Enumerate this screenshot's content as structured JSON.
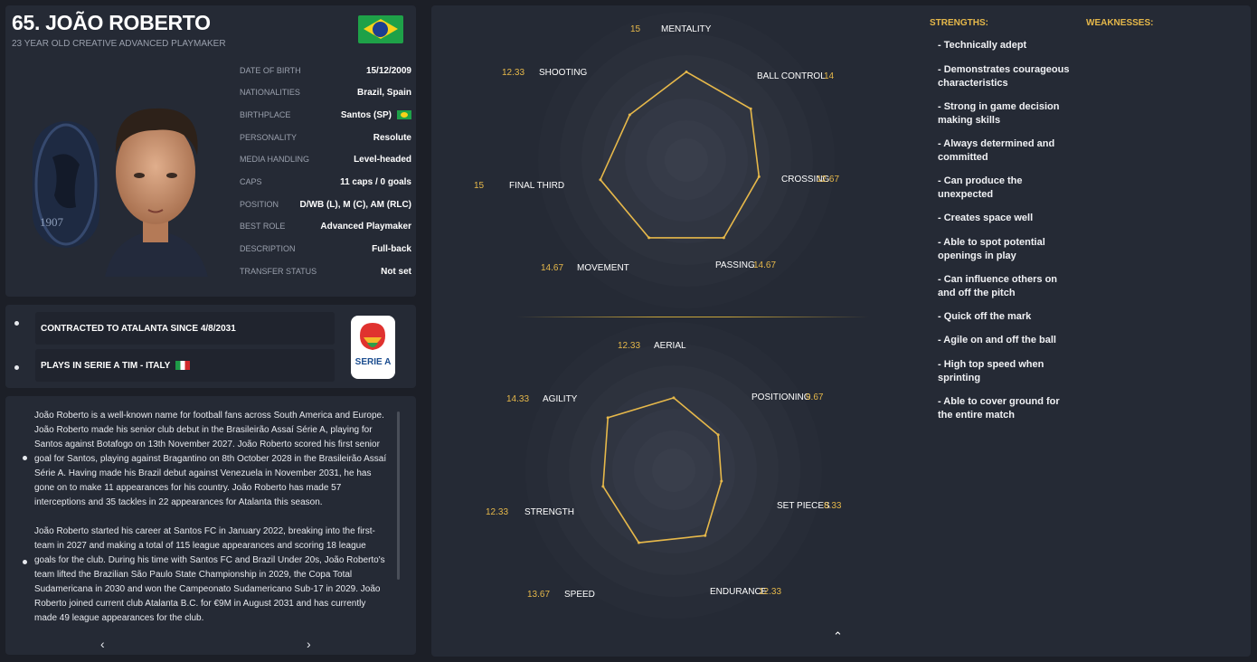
{
  "player": {
    "name": "65. JOÃO ROBERTO",
    "subtitle": "23 YEAR OLD CREATIVE ADVANCED PLAYMAKER",
    "club_crest_text": "1907"
  },
  "info": [
    {
      "label": "DATE OF BIRTH",
      "value": "15/12/2009"
    },
    {
      "label": "NATIONALITIES",
      "value": "Brazil, Spain"
    },
    {
      "label": "BIRTHPLACE",
      "value": "Santos (SP)"
    },
    {
      "label": "PERSONALITY",
      "value": "Resolute"
    },
    {
      "label": "MEDIA HANDLING",
      "value": "Level-headed"
    },
    {
      "label": "CAPS",
      "value": "11 caps / 0 goals"
    },
    {
      "label": "POSITION",
      "value": "D/WB (L), M (C), AM (RLC)"
    },
    {
      "label": "BEST ROLE",
      "value": "Advanced Playmaker"
    },
    {
      "label": "DESCRIPTION",
      "value": "Full-back"
    },
    {
      "label": "TRANSFER STATUS",
      "value": "Not set"
    }
  ],
  "contract": {
    "line1": "CONTRACTED TO ATALANTA SINCE 4/8/2031",
    "line2": "PLAYS IN SERIE A TIM - ITALY",
    "league_name": "SERIE A"
  },
  "bio": {
    "para1": "João Roberto is a well-known name for football fans across South America and Europe. João Roberto made his senior club debut in the Brasileirão Assaí Série A, playing for Santos against Botafogo on 13th November 2027. João Roberto scored his first senior goal for Santos, playing against Bragantino on 8th October 2028 in the Brasileirão Assaí Série A. Having made his Brazil debut against Venezuela in November 2031, he has gone on to make 11 appearances for his country. João Roberto has made 57 interceptions and 35 tackles in 22 appearances for Atalanta this season.",
    "para2": "João Roberto started his career at Santos FC in January 2022, breaking into the first-team in 2027 and making a total of 115 league appearances and scoring 18 league goals for the club. During his time with Santos FC and Brazil Under 20s, João Roberto's team lifted the Brazilian São Paulo State Championship in 2029, the Copa Total Sudamericana in 2030 and won the Campeonato Sudamericano Sub-17 in 2029. João Roberto joined current club Atalanta B.C. for €9M in August 2031 and has currently made 49 league appearances for the club.",
    "prev": "‹",
    "next": "›"
  },
  "radar_top": [
    {
      "label": "MENTALITY",
      "value": "15",
      "v": 15
    },
    {
      "label": "BALL CONTROL",
      "value": "14",
      "v": 14
    },
    {
      "label": "CROSSING",
      "value": "12.67",
      "v": 12.67
    },
    {
      "label": "PASSING",
      "value": "14.67",
      "v": 14.67
    },
    {
      "label": "MOVEMENT",
      "value": "14.67",
      "v": 14.67
    },
    {
      "label": "FINAL THIRD",
      "value": "15",
      "v": 15
    },
    {
      "label": "SHOOTING",
      "value": "12.33",
      "v": 12.33
    }
  ],
  "radar_bottom": [
    {
      "label": "AERIAL",
      "value": "12.33",
      "v": 12.33
    },
    {
      "label": "POSITIONING",
      "value": "9.67",
      "v": 9.67
    },
    {
      "label": "SET PIECES",
      "value": "8.33",
      "v": 8.33
    },
    {
      "label": "ENDURANCE",
      "value": "12.33",
      "v": 12.33
    },
    {
      "label": "SPEED",
      "value": "13.67",
      "v": 13.67
    },
    {
      "label": "STRENGTH",
      "value": "12.33",
      "v": 12.33
    },
    {
      "label": "AGILITY",
      "value": "14.33",
      "v": 14.33
    }
  ],
  "strengths_title": "STRENGTHS:",
  "weaknesses_title": "WEAKNESSES:",
  "strengths": [
    "- Technically adept",
    "- Demonstrates courageous characteristics",
    "- Strong in game decision making skills",
    "- Always determined and committed",
    "- Can produce the unexpected",
    "- Creates space well",
    "- Able to spot potential openings in play",
    "- Can influence others on and off the pitch",
    "- Quick off the mark",
    "- Agile on and off the ball",
    "- High top speed when sprinting",
    "- Able to cover ground for the entire match"
  ],
  "colors": {
    "accent": "#e6b84a",
    "panel": "#252a35",
    "background": "#1c1f27"
  },
  "icons": {
    "collapse": "chevron-up-icon",
    "prev": "chevron-left-icon",
    "next": "chevron-right-icon"
  }
}
